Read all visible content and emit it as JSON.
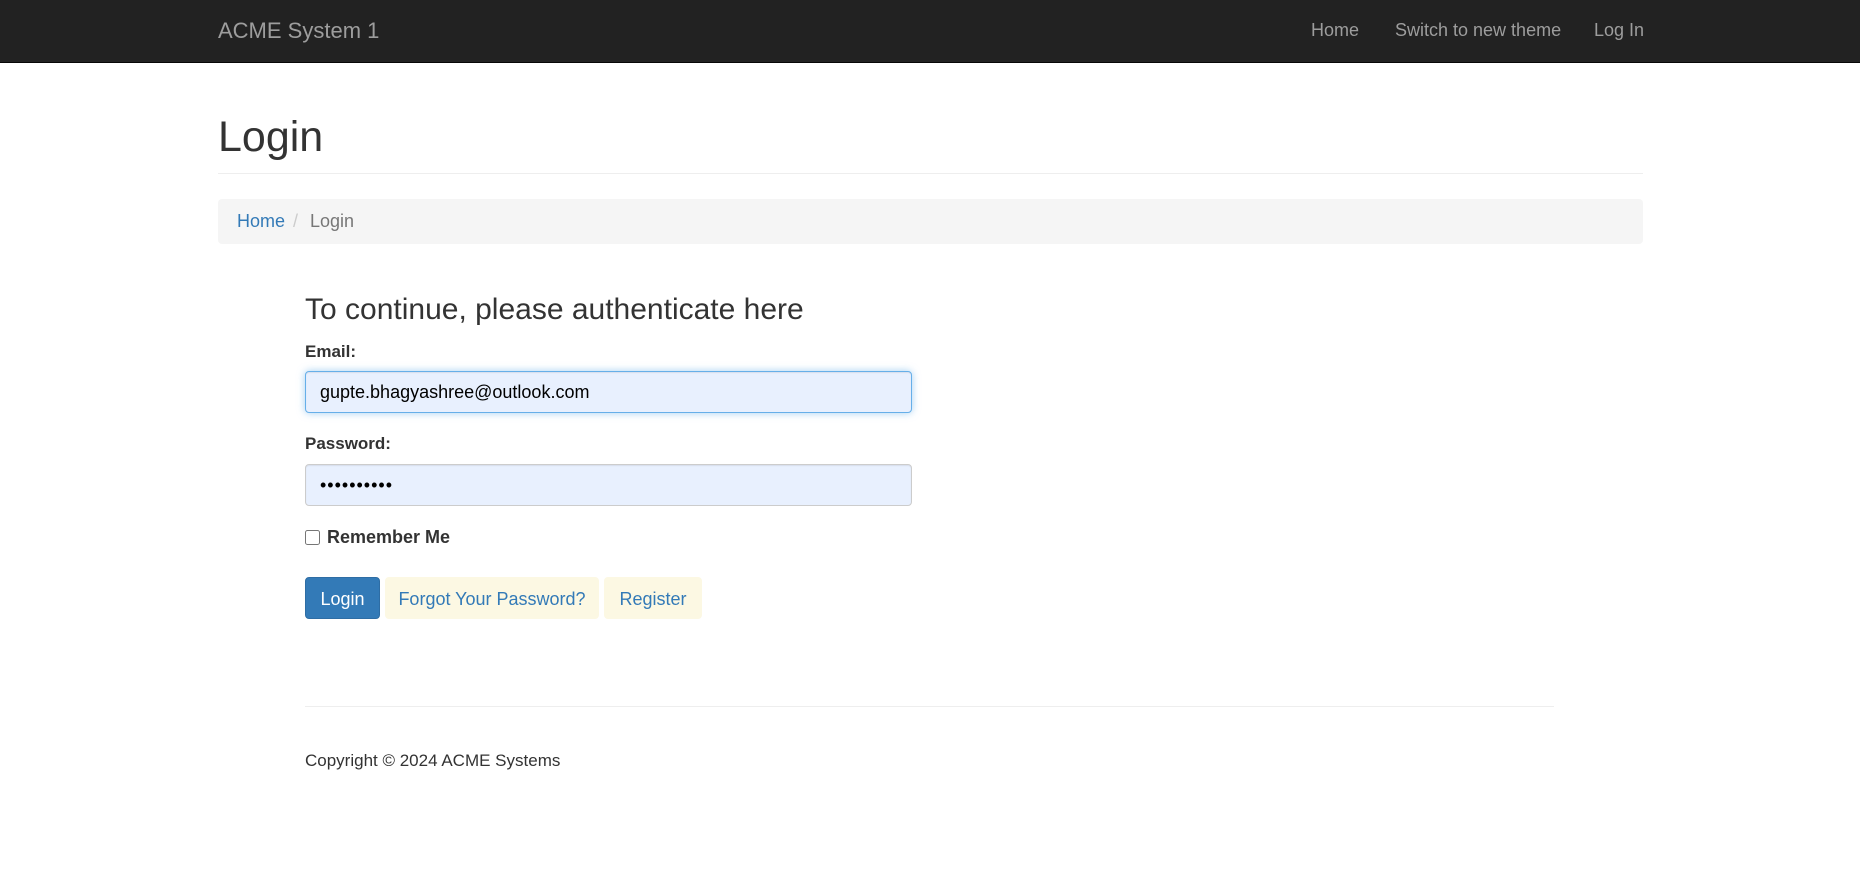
{
  "navbar": {
    "brand": "ACME System 1",
    "links": [
      "Home",
      "Switch to new theme",
      "Log In"
    ]
  },
  "page": {
    "title": "Login"
  },
  "breadcrumb": {
    "home": "Home",
    "separator": "/",
    "active": "Login"
  },
  "form": {
    "heading": "To continue, please authenticate here",
    "email_label": "Email:",
    "email_value": "gupte.bhagyashree@outlook.com",
    "password_label": "Password:",
    "password_value": "••••••••••",
    "remember_label": "Remember Me",
    "remember_checked": false,
    "buttons": {
      "login": "Login",
      "forgot": "Forgot Your Password?",
      "register": "Register"
    }
  },
  "footer": {
    "copyright": "Copyright © 2024 ACME Systems"
  },
  "colors": {
    "navbar_bg": "#222222",
    "link": "#337ab7",
    "primary_button": "#337ab7",
    "warning_button_bg": "#fcf8e3",
    "input_autofill_bg": "#e8f0fe"
  }
}
